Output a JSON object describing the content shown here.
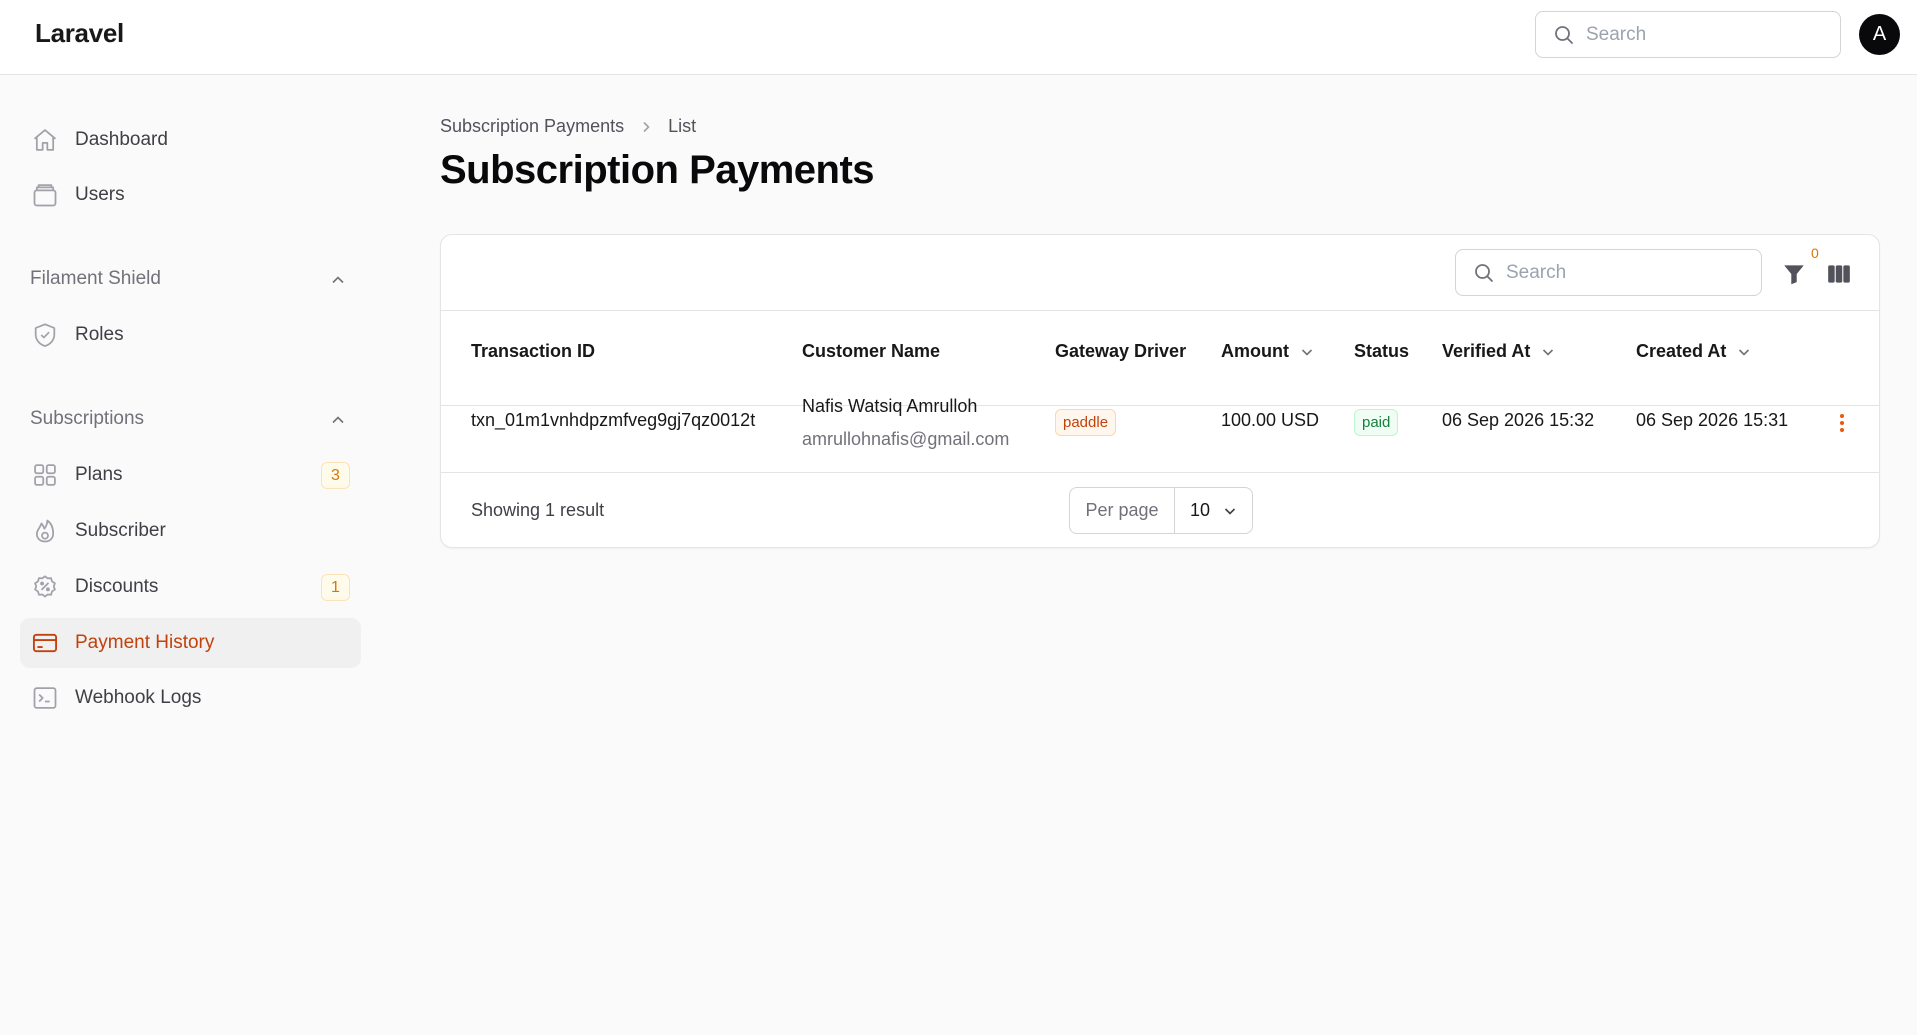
{
  "topbar": {
    "brand": "Laravel",
    "search_placeholder": "Search",
    "avatar_initial": "A"
  },
  "sidebar": {
    "items": [
      {
        "label": "Dashboard",
        "icon": "home-icon"
      },
      {
        "label": "Users",
        "icon": "folder-icon"
      }
    ],
    "groups": [
      {
        "label": "Filament Shield",
        "items": [
          {
            "label": "Roles",
            "icon": "shield-check-icon"
          }
        ]
      },
      {
        "label": "Subscriptions",
        "items": [
          {
            "label": "Plans",
            "icon": "grid-icon",
            "badge": "3"
          },
          {
            "label": "Subscriber",
            "icon": "fire-icon"
          },
          {
            "label": "Discounts",
            "icon": "discount-icon",
            "badge": "1"
          },
          {
            "label": "Payment History",
            "icon": "credit-card-icon",
            "active": true
          },
          {
            "label": "Webhook Logs",
            "icon": "terminal-icon"
          }
        ]
      }
    ]
  },
  "breadcrumb": {
    "parent": "Subscription Payments",
    "current": "List"
  },
  "page_title": "Subscription Payments",
  "table": {
    "search_placeholder": "Search",
    "filter_count": "0",
    "columns": [
      "Transaction ID",
      "Customer Name",
      "Gateway Driver",
      "Amount",
      "Status",
      "Verified At",
      "Created At"
    ],
    "rows": [
      {
        "transaction_id": "txn_01m1vnhdpzmfveg9gj7qz0012t",
        "customer_name": "Nafis Watsiq Amrulloh",
        "customer_email": "amrullohnafis@gmail.com",
        "gateway_driver": "paddle",
        "amount": "100.00 USD",
        "status": "paid",
        "verified_at": "06 Sep 2026 15:32",
        "created_at": "06 Sep 2026 15:31"
      }
    ],
    "footer": {
      "showing": "Showing 1 result",
      "per_page_label": "Per page",
      "per_page_value": "10"
    }
  },
  "colors": {
    "accent": "#c2410c",
    "badge_warning": "#d97706",
    "success": "#15803d"
  }
}
